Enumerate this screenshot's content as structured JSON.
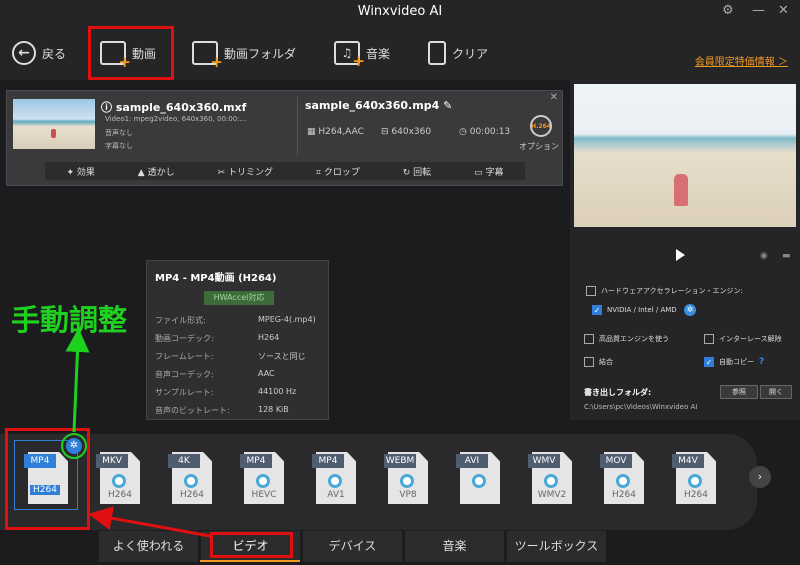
{
  "app": {
    "title": "Winxvideo AI"
  },
  "toolbar": {
    "back": "戻る",
    "video": "動画",
    "video_folder": "動画フォルダ",
    "music": "音楽",
    "clear": "クリア",
    "member_link": "会員限定特価情報 ＞"
  },
  "task": {
    "source_name": "sample_640x360.mxf",
    "source_video": "Video1: mpeg2video, 640x360, 00:00:...",
    "source_audio": "音声なし",
    "source_subtitle": "字幕なし",
    "output_name": "sample_640x360.mp4",
    "output_codec": "H264,AAC",
    "output_resolution": "640x360",
    "output_duration": "00:00:13",
    "option_label": "オプション",
    "gear_badge": "H.264",
    "edit": [
      "効果",
      "透かし",
      "トリミング",
      "クロップ",
      "回転",
      "字幕"
    ]
  },
  "popup": {
    "title": "MP4 - MP4動画 (H264)",
    "hw_badge": "HWAccel対応",
    "rows": [
      {
        "key": "ファイル形式:",
        "value": "MPEG-4(.mp4)"
      },
      {
        "key": "動画コーデック:",
        "value": "H264"
      },
      {
        "key": "フレームレート:",
        "value": "ソースと同じ"
      },
      {
        "key": "音声コーデック:",
        "value": "AAC"
      },
      {
        "key": "サンプルレート:",
        "value": "44100 Hz"
      },
      {
        "key": "音声のビットレート:",
        "value": "128 KiB"
      }
    ]
  },
  "annotation": {
    "label": "手動調整"
  },
  "settings": {
    "hw_engine": "ハードウェアアクセラレーション・エンジン:",
    "gpu": "NVIDIA / Intel / AMD",
    "hq_engine": "高品質エンジンを使う",
    "deinterlace": "インターレース解除",
    "merge": "結合",
    "auto_copy": "自動コピー",
    "output_folder_label": "書き出しフォルダ:",
    "browse": "参照",
    "open": "開く",
    "output_path": "C:\\Users\\pc\\Videos\\Winxvideo AI"
  },
  "formats": [
    {
      "top": "MP4",
      "bottom": "H264"
    },
    {
      "top": "MKV",
      "bottom": "H264"
    },
    {
      "top": "4K",
      "bottom": "H264"
    },
    {
      "top": "MP4",
      "bottom": "HEVC"
    },
    {
      "top": "MP4",
      "bottom": "AV1"
    },
    {
      "top": "WEBM",
      "bottom": "VP8"
    },
    {
      "top": "AVI",
      "bottom": ""
    },
    {
      "top": "WMV",
      "bottom": "WMV2"
    },
    {
      "top": "MOV",
      "bottom": "H264"
    },
    {
      "top": "M4V",
      "bottom": "H264"
    }
  ],
  "tabs": [
    "よく使われる",
    "ビデオ",
    "デバイス",
    "音楽",
    "ツールボックス"
  ]
}
